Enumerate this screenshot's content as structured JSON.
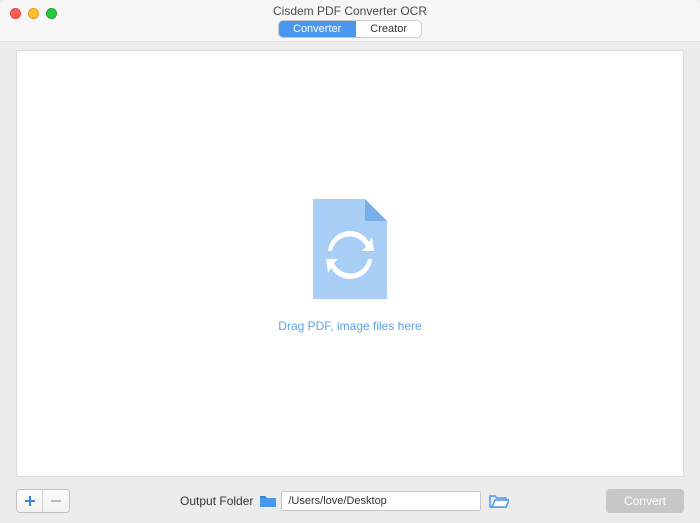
{
  "window": {
    "title": "Cisdem PDF Converter OCR"
  },
  "tabs": {
    "converter": "Converter",
    "creator": "Creator"
  },
  "dropzone": {
    "hint": "Drag PDF, image files here"
  },
  "footer": {
    "output_label": "Output Folder",
    "path_value": "/Users/love/Desktop",
    "convert_label": "Convert"
  },
  "colors": {
    "accent": "#4a97ef",
    "icon_light": "#a9cef6",
    "icon_dark": "#79aee8"
  }
}
